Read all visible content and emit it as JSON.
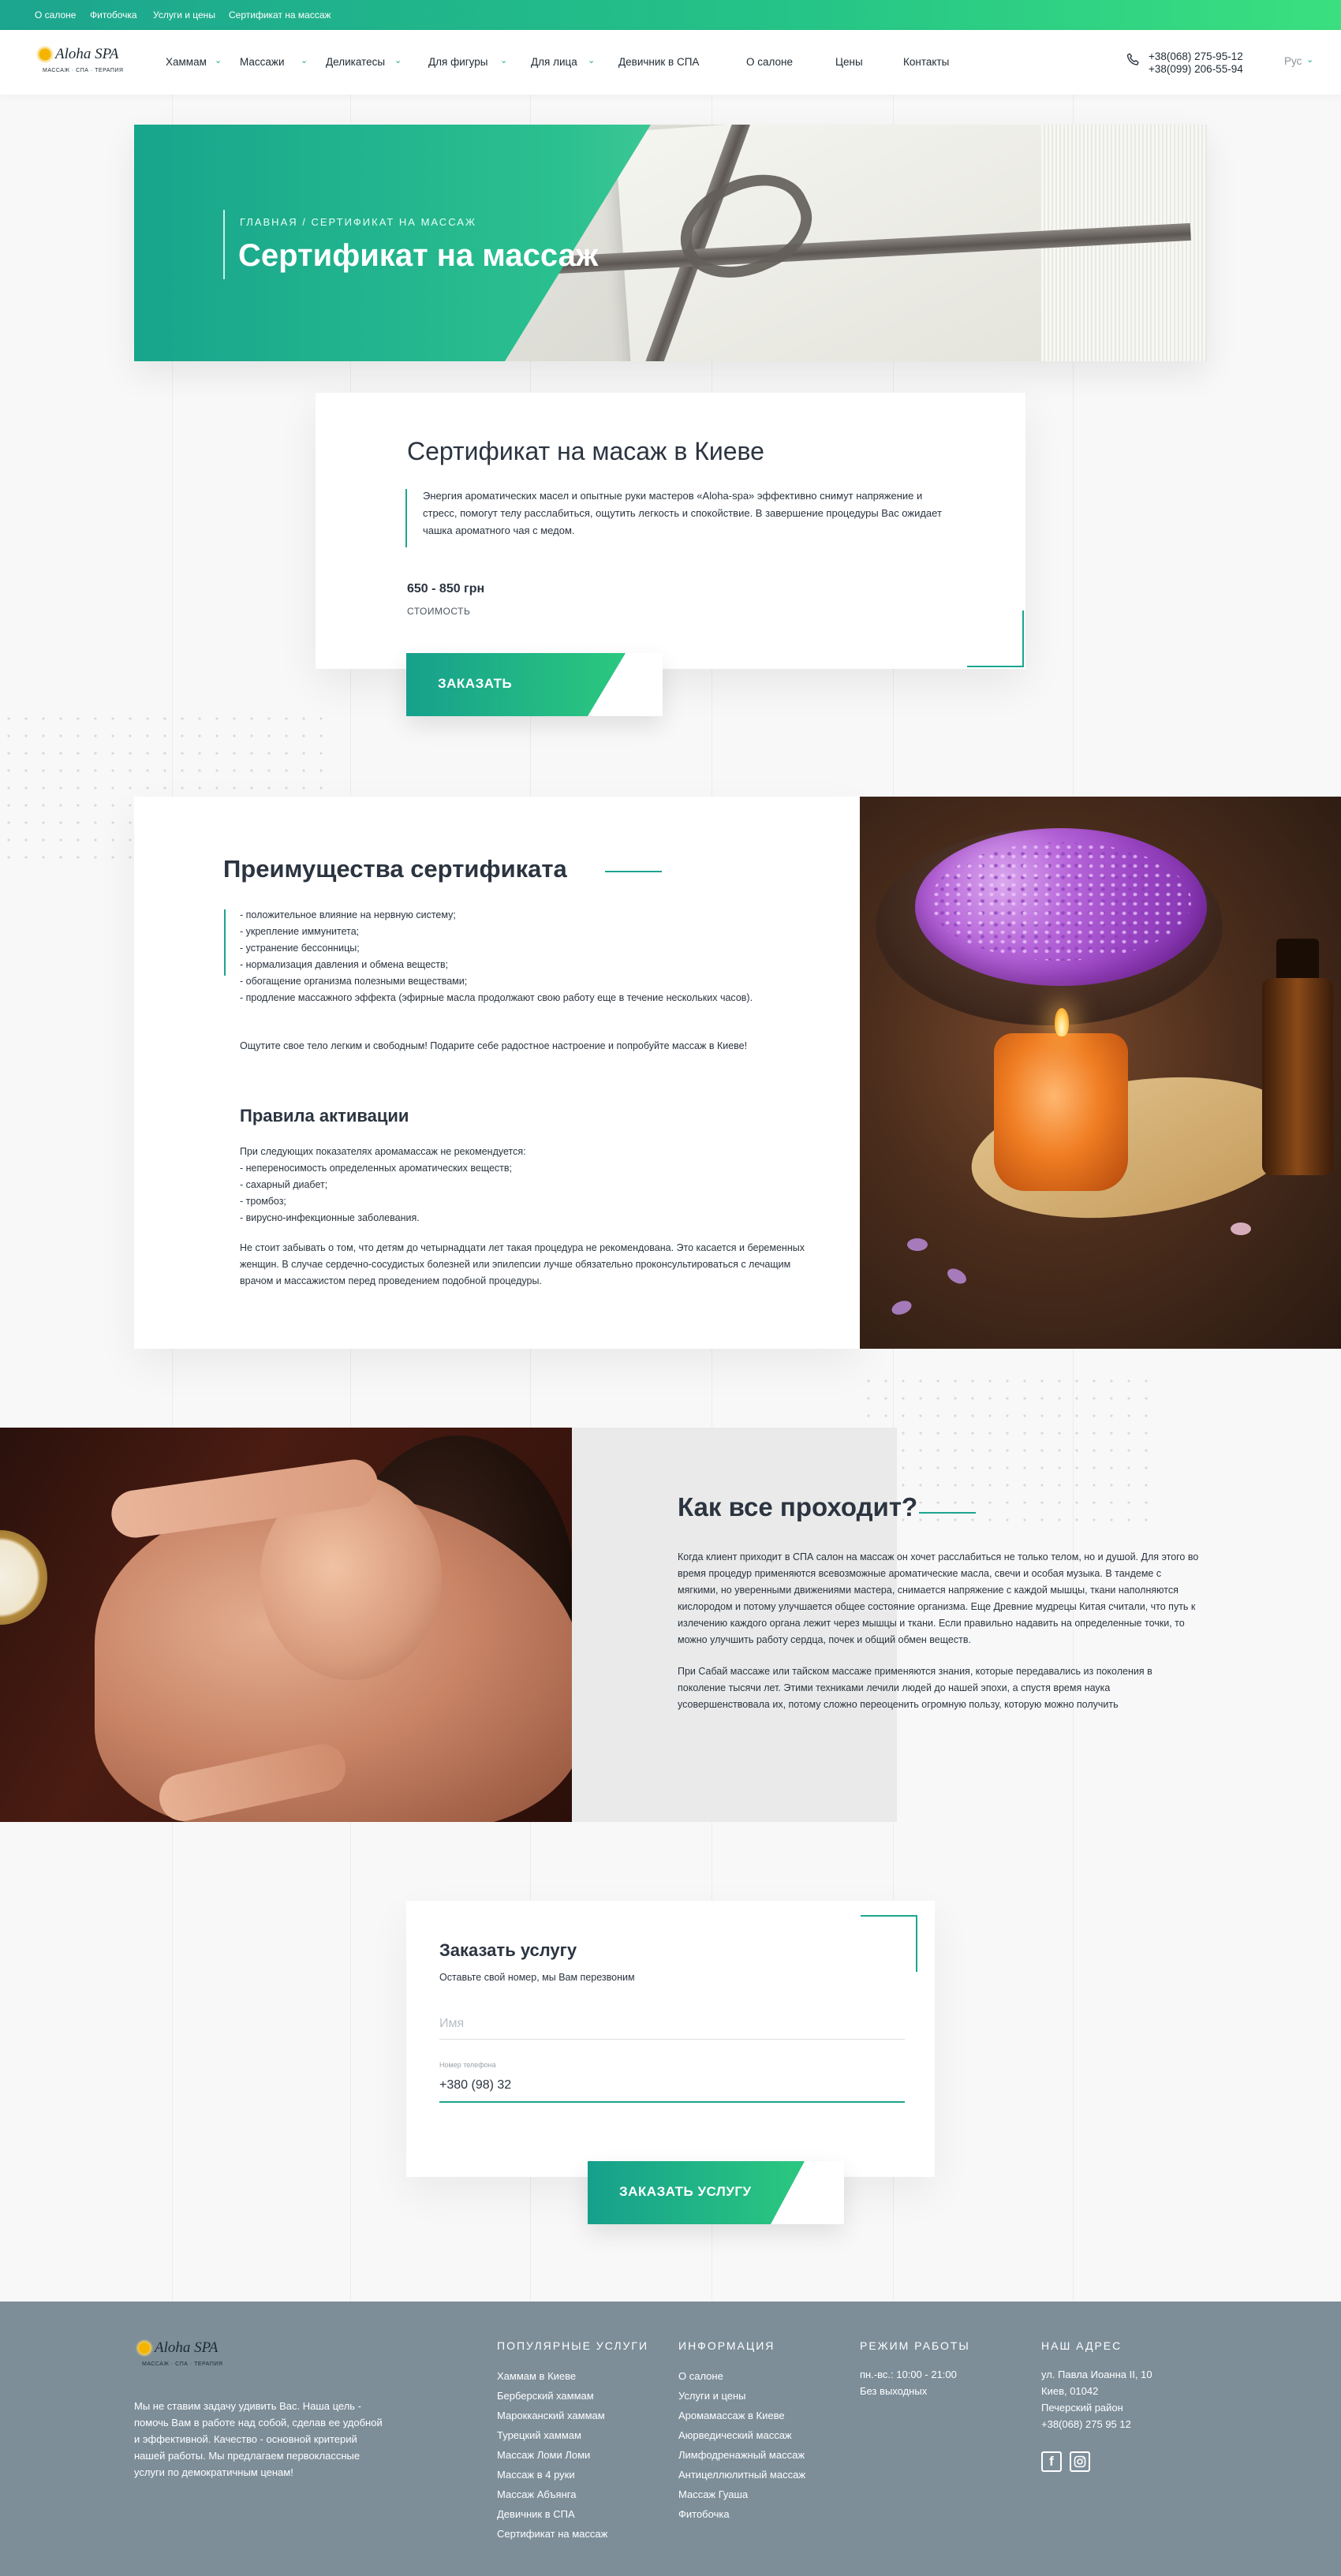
{
  "topbar": {
    "links": [
      "О салоне",
      "Фитобочка",
      "Услуги и цены",
      "Сертификат на массаж"
    ]
  },
  "header": {
    "logo": {
      "name": "Aloha SPA",
      "tagline": "МАССАЖ · СПА · ТЕРАПИЯ"
    },
    "nav": [
      {
        "label": "Хаммам",
        "dropdown": true
      },
      {
        "label": "Массажи",
        "dropdown": true
      },
      {
        "label": "Деликатесы",
        "dropdown": true
      },
      {
        "label": "Для фигуры",
        "dropdown": true
      },
      {
        "label": "Для лица",
        "dropdown": true
      },
      {
        "label": "Девичник в СПА",
        "dropdown": false
      },
      {
        "label": "О салоне",
        "dropdown": false
      },
      {
        "label": "Цены",
        "dropdown": false
      },
      {
        "label": "Контакты",
        "dropdown": false
      }
    ],
    "phones": [
      "+38(068) 275-95-12",
      "+38(099) 206-55-94"
    ],
    "language": "Рус"
  },
  "hero": {
    "breadcrumb_home": "Главная",
    "breadcrumb_sep": " / ",
    "breadcrumb_current": "Сертификат на массаж",
    "title": "Сертификат на массаж"
  },
  "certificate": {
    "title": "Сертификат на масаж в Киеве",
    "description": "Энергия ароматических масел и опытные руки мастеров «Aloha-spa» эффективно снимут напряжение и стресс, помогут телу расслабиться, ощутить легкость и спокойствие.  В завершение процедуры Вас ожидает чашка ароматного чая с медом.",
    "price": "650 - 850 грн",
    "price_label": "стоимость",
    "order_button": "ЗАКАЗАТЬ"
  },
  "benefits": {
    "title": "Преимущества сертификата",
    "items": [
      "- положительное влияние на нервную систему;",
      "- укрепление иммунитета;",
      "- устранение бессонницы;",
      "- нормализация давления и обмена веществ;",
      "- обогащение организма полезными веществами;",
      "- продление массажного эффекта (эфирные масла продолжают свою работу еще в течение нескольких часов)."
    ],
    "outro": "Ощутите свое тело легким и свободным! Подарите себе радостное настроение и попробуйте массаж в Киеве!",
    "rules_title": "Правила активации",
    "rules_intro": "При следующих показателях аромамассаж не рекомендуется:",
    "rules": [
      "- непереносимость определенных ароматических веществ;",
      "- сахарный диабет;",
      "- тромбоз;",
      "- вирусно-инфекционные заболевания."
    ],
    "rules_note": "Не стоит забывать о том, что детям до четырнадцати лет такая процедура не рекомендована. Это касается и беременных женщин. В случае сердечно-сосудистых болезней или эпилепсии лучше обязательно проконсультироваться с лечащим врачом и массажистом перед проведением подобной процедуры."
  },
  "how": {
    "title": "Как все проходит?",
    "p1": "Когда клиент приходит в СПА салон на массаж он хочет расслабиться не только телом, но и душой. Для этого во время процедур применяются всевозможные ароматические масла, свечи и особая музыка. В тандеме с мягкими, но уверенными движениями мастера, снимается напряжение с каждой мышцы, ткани наполняются кислородом и потому улучшается общее состояние организма. Еще Древние мудрецы Китая считали, что путь к излечению каждого органа лежит через мышцы и ткани. Если правильно надавить на определенные точки, то можно улучшить работу сердца, почек и общий обмен веществ.",
    "p2": "При Сабай массаже или тайском массаже применяются знания, которые передавались из поколения в поколение тысячи лет. Этими техниками лечили людей до нашей эпохи, а спустя время наука усовершенствовала их, потому сложно переоценить огромную пользу, которую можно получить"
  },
  "order_form": {
    "title": "Заказать услугу",
    "subtitle": "Оставьте свой номер, мы Вам перезвоним",
    "name_placeholder": "Имя",
    "phone_label": "Номер телефона",
    "phone_value": "+380 (98) 32",
    "submit": "ЗАКАЗАТЬ УСЛУГУ"
  },
  "footer": {
    "logo": {
      "name": "Aloha SPA",
      "tagline": "МАССАЖ · СПА · ТЕРАПИЯ"
    },
    "about": "Мы не ставим задачу удивить Вас. Наша цель - помочь Вам в работе над собой, сделав ее удобной и эффективной. Качество - основной критерий нашей работы. Мы предлагаем первоклассные услуги по демократичным ценам!",
    "popular_title": "Популярные услуги",
    "popular": [
      "Хаммам в Киеве",
      "Берберский хаммам",
      "Марокканский хаммам",
      "Турецкий хаммам",
      "Массаж Ломи Ломи",
      "Массаж в 4 руки",
      "Массаж Абъянга",
      "Девичник в СПА",
      "Сертификат на массаж"
    ],
    "info_title": "Информация",
    "info": [
      "О салоне",
      "Услуги и цены",
      "Аромамассаж в Киеве",
      "Аюрведический массаж",
      "Лимфодренажный массаж",
      "Антицеллюлитный массаж",
      "Массаж Гуаша",
      "Фитобочка"
    ],
    "hours_title": "Режим работы",
    "hours": [
      "пн.-вс.: 10:00 - 21:00",
      "Без выходных"
    ],
    "address_title": "Наш адрес",
    "address": [
      "ул. Павла Иоанна II, 10",
      "Киев, 01042",
      "Печерский район",
      "+38(068) 275 95 12"
    ]
  }
}
